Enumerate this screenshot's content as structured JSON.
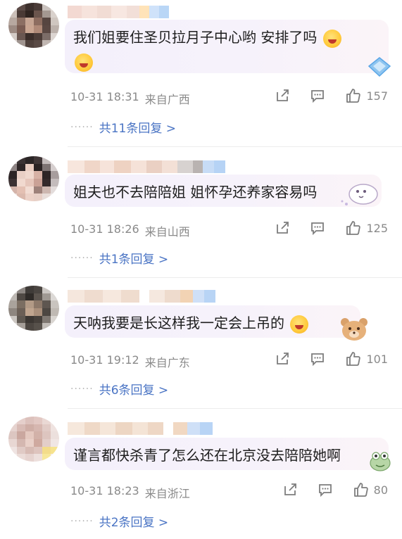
{
  "comments": [
    {
      "text": "我们姐要住圣贝拉月子中心哟 安排了吗",
      "time": "10-31 18:31",
      "location": "来自广西",
      "likes": "157",
      "replies": "共11条回复 >",
      "emoji": "smiley-face-emoji",
      "decoration": "blue-diamond-sticker"
    },
    {
      "text": "姐夫也不去陪陪姐 姐怀孕还养家容易吗",
      "time": "10-31 18:26",
      "location": "来自山西",
      "likes": "125",
      "replies": "共1条回复 >",
      "decoration": "cartoon-sheep-sticker"
    },
    {
      "text": "天呐我要是长这样我一定会上吊的",
      "time": "10-31 19:12",
      "location": "来自广东",
      "likes": "101",
      "replies": "共6条回复 >",
      "emoji": "crying-face-emoji",
      "decoration": "bear-sticker"
    },
    {
      "text": "谨言都快杀青了怎么还在北京没去陪陪她啊",
      "time": "10-31 18:23",
      "location": "来自浙江",
      "likes": "80",
      "replies": "共2条回复 >",
      "decoration": "frog-sticker"
    }
  ],
  "reply_dots": "······",
  "colors": {
    "reply_link": "#4a74c4",
    "meta_text": "#8a8a8a",
    "bubble_start": "#f4f0fb",
    "bubble_end": "#fbf4f8"
  }
}
